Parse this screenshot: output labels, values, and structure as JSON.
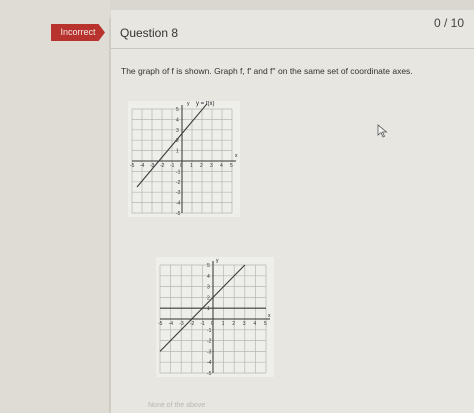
{
  "status_badge": {
    "label": "Incorrect",
    "color": "#b8332e"
  },
  "question": {
    "title": "Question 8",
    "score": "0 / 10",
    "prompt": "The graph of f is shown. Graph f, f' and f'' on the same set of coordinate axes."
  },
  "graph1": {
    "function_label": "y = f(x)",
    "axis_x_label": "x",
    "axis_y_label": "y",
    "x_ticks": [
      "-5",
      "-4",
      "-3",
      "-2",
      "-1",
      "0",
      "1",
      "2",
      "3",
      "4",
      "5"
    ],
    "y_ticks": [
      "5",
      "4",
      "3",
      "2",
      "1",
      "-1",
      "-2",
      "-3",
      "-4",
      "-5"
    ]
  },
  "graph2": {
    "axis_x_label": "x",
    "axis_y_label": "y",
    "x_ticks": [
      "-5",
      "-4",
      "-3",
      "-2",
      "-1",
      "0",
      "1",
      "2",
      "3",
      "4",
      "5"
    ],
    "y_ticks": [
      "5",
      "4",
      "3",
      "2",
      "1",
      "-1",
      "-2",
      "-3",
      "-4",
      "-5"
    ]
  },
  "footer": {
    "text": "None of the above"
  },
  "icons": {
    "cursor": "pointer-cursor-icon"
  }
}
